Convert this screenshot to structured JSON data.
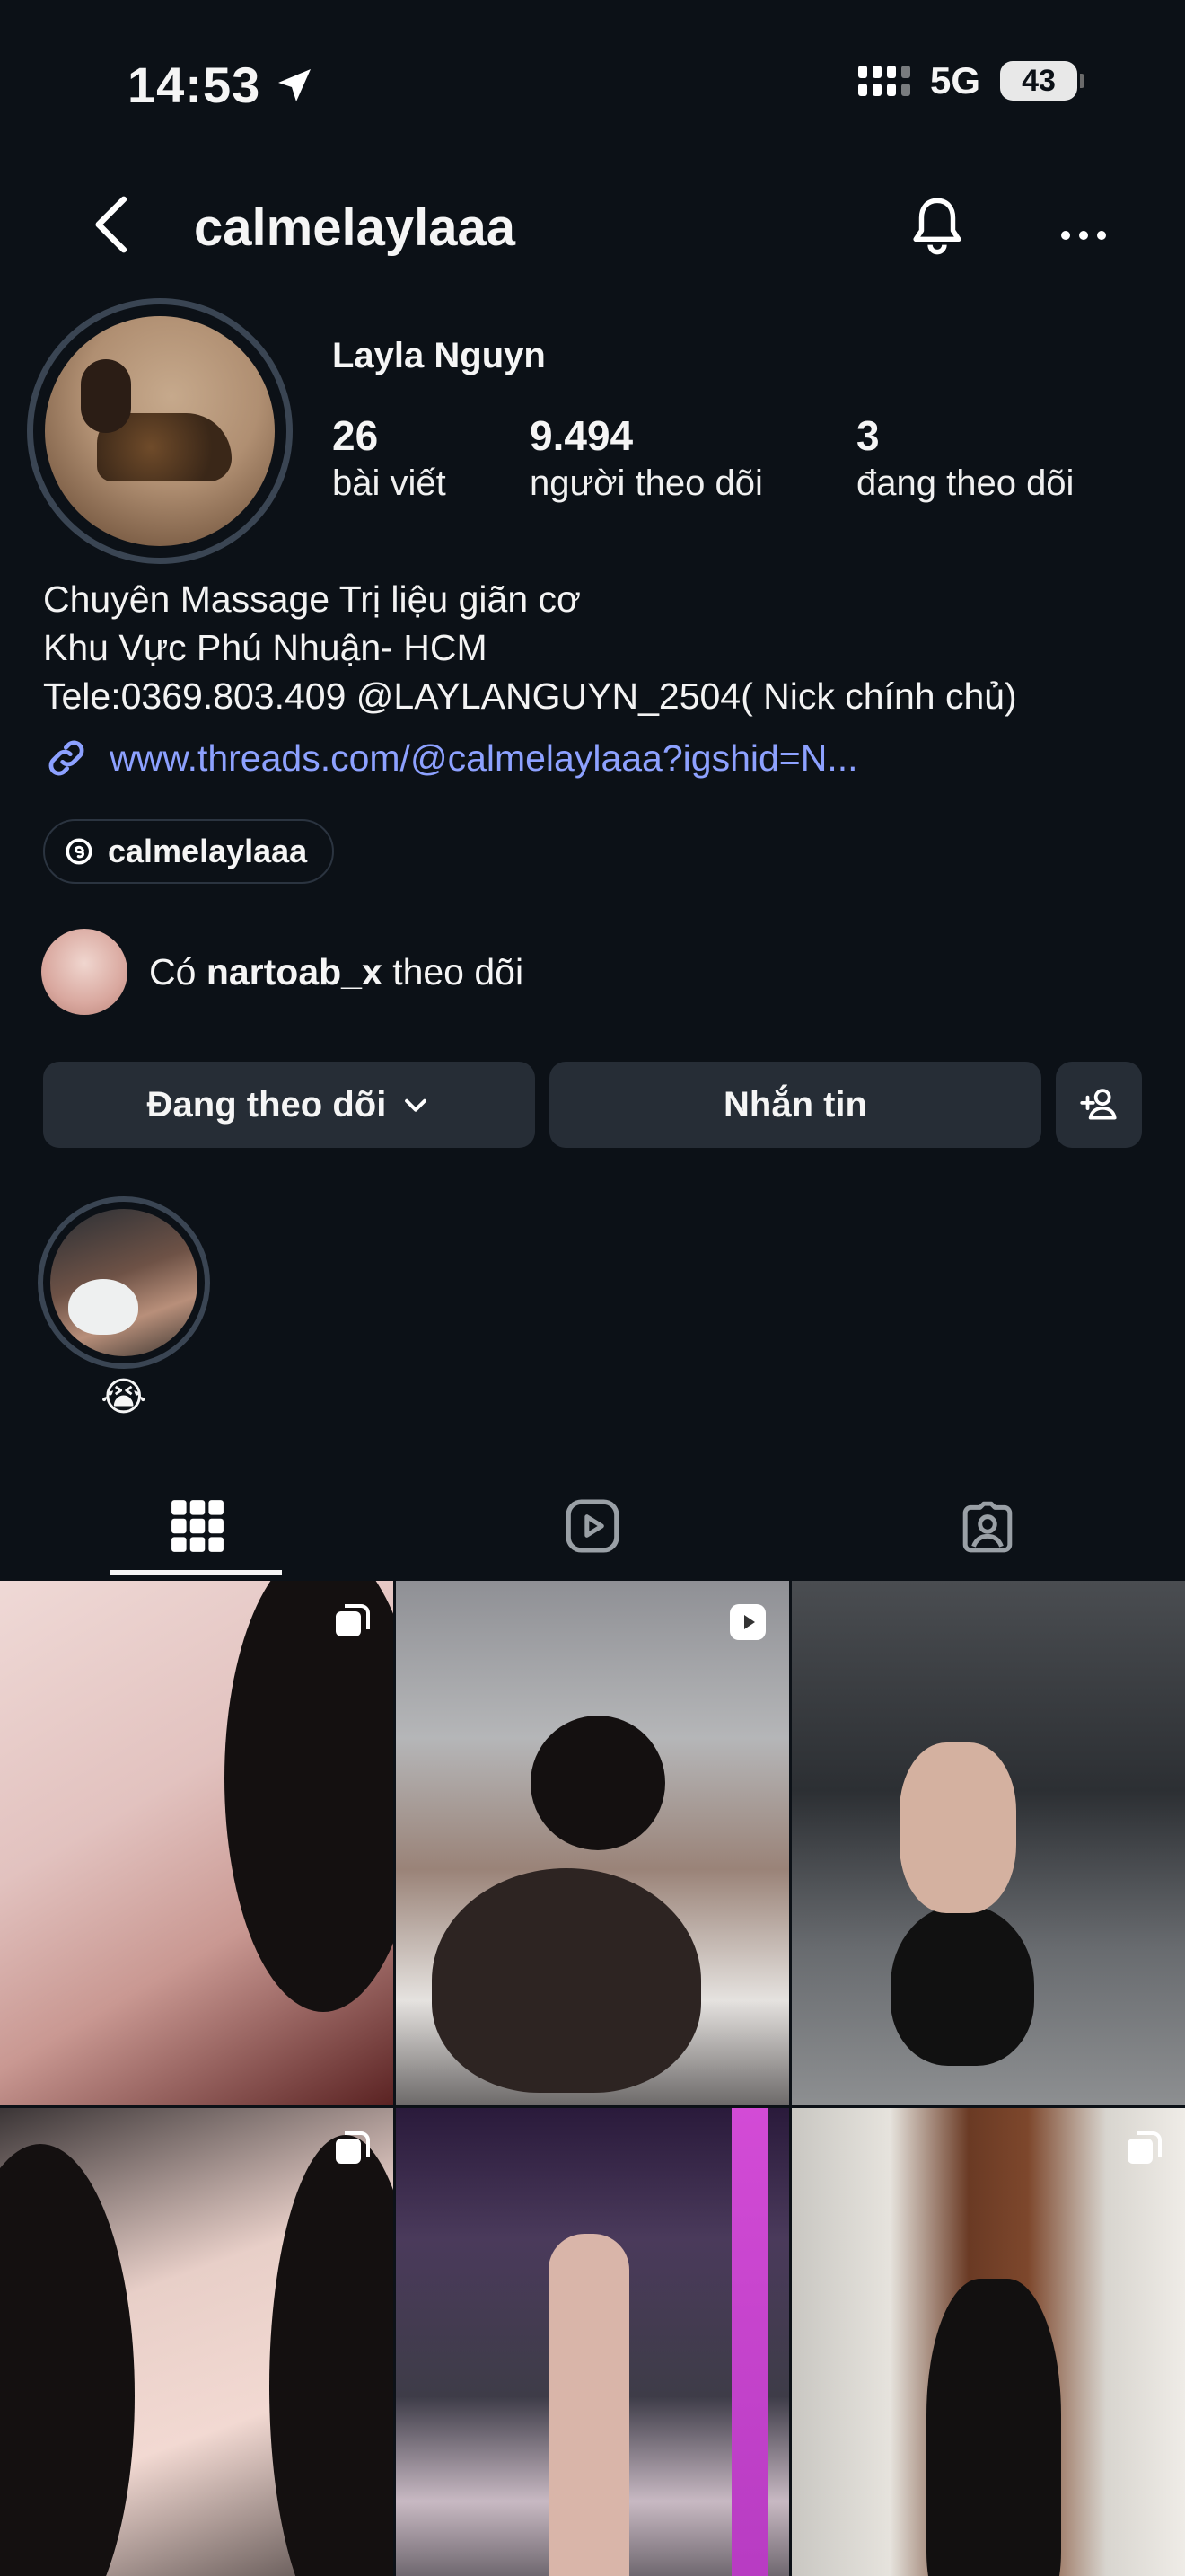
{
  "status_bar": {
    "time": "14:53",
    "network": "5G",
    "battery": "43"
  },
  "header": {
    "username": "calmelaylaaa"
  },
  "profile": {
    "display_name": "Layla Nguyn",
    "stats": {
      "posts_count": "26",
      "posts_label": "bài viết",
      "followers_count": "9.494",
      "followers_label": "người theo dõi",
      "following_count": "3",
      "following_label": "đang theo dõi"
    },
    "bio": [
      "Chuyên Massage Trị liệu giãn cơ",
      "Khu Vực Phú Nhuận- HCM",
      "Tele:0369.803.409 @LAYLANGUYN_2504( Nick chính chủ)"
    ],
    "link": "www.threads.com/@calmelaylaaa?igshid=N...",
    "threads_handle": "calmelaylaaa"
  },
  "mutual": {
    "prefix": "Có",
    "name": "nartoab_x",
    "suffix": "theo dõi"
  },
  "actions": {
    "following_label": "Đang theo dõi",
    "message_label": "Nhắn tin"
  },
  "highlights": [
    {
      "label": "😭"
    }
  ],
  "tabs": [
    {
      "name": "posts-grid",
      "icon": "grid-icon",
      "active": true
    },
    {
      "name": "reels",
      "icon": "reels-icon",
      "active": false
    },
    {
      "name": "tagged",
      "icon": "tagged-icon",
      "active": false
    }
  ],
  "posts": [
    {
      "badge": "carousel-icon"
    },
    {
      "badge": "reel-icon"
    },
    {
      "badge": ""
    },
    {
      "badge": "carousel-icon"
    },
    {
      "badge": ""
    },
    {
      "badge": "carousel-icon"
    }
  ],
  "colors": {
    "background": "#0c1117",
    "button": "#262d36",
    "link": "#8da1ff"
  }
}
